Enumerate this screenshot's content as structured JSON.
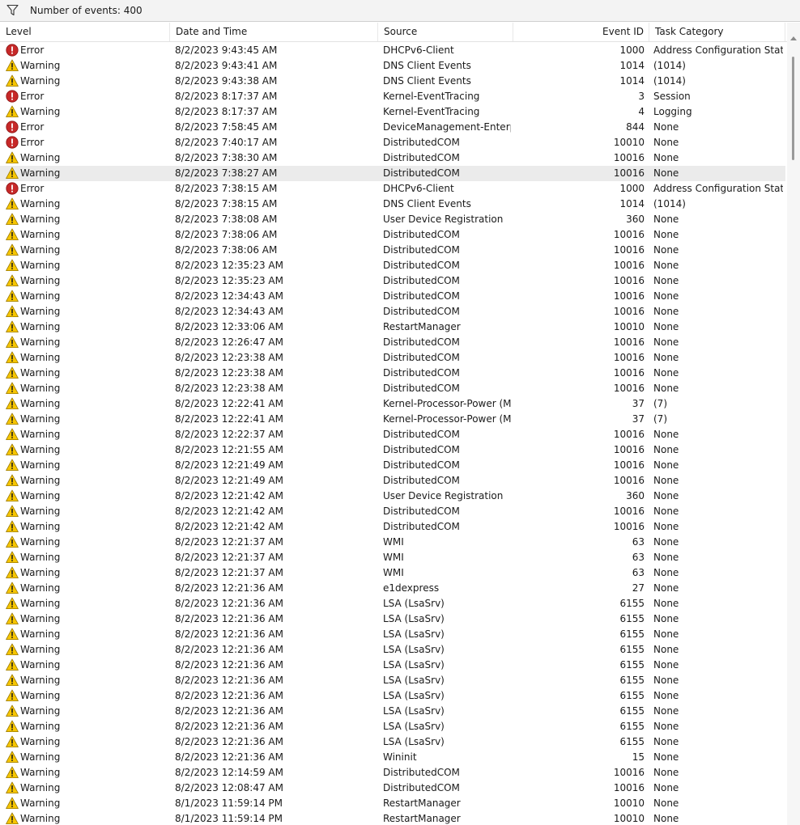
{
  "toolbar": {
    "event_count": "Number of events: 400",
    "filter_icon": "filter-funnel-icon"
  },
  "columns": {
    "level": "Level",
    "date": "Date and Time",
    "source": "Source",
    "event_id": "Event ID",
    "category": "Task Category"
  },
  "colors": {
    "error": "#c62828",
    "warning": "#f7c600",
    "selected_row": "#ebebeb"
  },
  "icons": {
    "error": "error-icon",
    "warning": "warning-icon"
  },
  "selected_row_index": 8,
  "rows": [
    {
      "level": "Error",
      "type": "error",
      "date": "8/2/2023 9:43:45 AM",
      "source": "DHCPv6-Client",
      "id": "1000",
      "category": "Address Configuration Stat…"
    },
    {
      "level": "Warning",
      "type": "warning",
      "date": "8/2/2023 9:43:41 AM",
      "source": "DNS Client Events",
      "id": "1014",
      "category": "(1014)"
    },
    {
      "level": "Warning",
      "type": "warning",
      "date": "8/2/2023 9:43:38 AM",
      "source": "DNS Client Events",
      "id": "1014",
      "category": "(1014)"
    },
    {
      "level": "Error",
      "type": "error",
      "date": "8/2/2023 8:17:37 AM",
      "source": "Kernel-EventTracing",
      "id": "3",
      "category": "Session"
    },
    {
      "level": "Warning",
      "type": "warning",
      "date": "8/2/2023 8:17:37 AM",
      "source": "Kernel-EventTracing",
      "id": "4",
      "category": "Logging"
    },
    {
      "level": "Error",
      "type": "error",
      "date": "8/2/2023 7:58:45 AM",
      "source": "DeviceManagement-Enterp…",
      "id": "844",
      "category": "None"
    },
    {
      "level": "Error",
      "type": "error",
      "date": "8/2/2023 7:40:17 AM",
      "source": "DistributedCOM",
      "id": "10010",
      "category": "None"
    },
    {
      "level": "Warning",
      "type": "warning",
      "date": "8/2/2023 7:38:30 AM",
      "source": "DistributedCOM",
      "id": "10016",
      "category": "None"
    },
    {
      "level": "Warning",
      "type": "warning",
      "date": "8/2/2023 7:38:27 AM",
      "source": "DistributedCOM",
      "id": "10016",
      "category": "None"
    },
    {
      "level": "Error",
      "type": "error",
      "date": "8/2/2023 7:38:15 AM",
      "source": "DHCPv6-Client",
      "id": "1000",
      "category": "Address Configuration Stat…"
    },
    {
      "level": "Warning",
      "type": "warning",
      "date": "8/2/2023 7:38:15 AM",
      "source": "DNS Client Events",
      "id": "1014",
      "category": "(1014)"
    },
    {
      "level": "Warning",
      "type": "warning",
      "date": "8/2/2023 7:38:08 AM",
      "source": "User Device Registration",
      "id": "360",
      "category": "None"
    },
    {
      "level": "Warning",
      "type": "warning",
      "date": "8/2/2023 7:38:06 AM",
      "source": "DistributedCOM",
      "id": "10016",
      "category": "None"
    },
    {
      "level": "Warning",
      "type": "warning",
      "date": "8/2/2023 7:38:06 AM",
      "source": "DistributedCOM",
      "id": "10016",
      "category": "None"
    },
    {
      "level": "Warning",
      "type": "warning",
      "date": "8/2/2023 12:35:23 AM",
      "source": "DistributedCOM",
      "id": "10016",
      "category": "None"
    },
    {
      "level": "Warning",
      "type": "warning",
      "date": "8/2/2023 12:35:23 AM",
      "source": "DistributedCOM",
      "id": "10016",
      "category": "None"
    },
    {
      "level": "Warning",
      "type": "warning",
      "date": "8/2/2023 12:34:43 AM",
      "source": "DistributedCOM",
      "id": "10016",
      "category": "None"
    },
    {
      "level": "Warning",
      "type": "warning",
      "date": "8/2/2023 12:34:43 AM",
      "source": "DistributedCOM",
      "id": "10016",
      "category": "None"
    },
    {
      "level": "Warning",
      "type": "warning",
      "date": "8/2/2023 12:33:06 AM",
      "source": "RestartManager",
      "id": "10010",
      "category": "None"
    },
    {
      "level": "Warning",
      "type": "warning",
      "date": "8/2/2023 12:26:47 AM",
      "source": "DistributedCOM",
      "id": "10016",
      "category": "None"
    },
    {
      "level": "Warning",
      "type": "warning",
      "date": "8/2/2023 12:23:38 AM",
      "source": "DistributedCOM",
      "id": "10016",
      "category": "None"
    },
    {
      "level": "Warning",
      "type": "warning",
      "date": "8/2/2023 12:23:38 AM",
      "source": "DistributedCOM",
      "id": "10016",
      "category": "None"
    },
    {
      "level": "Warning",
      "type": "warning",
      "date": "8/2/2023 12:23:38 AM",
      "source": "DistributedCOM",
      "id": "10016",
      "category": "None"
    },
    {
      "level": "Warning",
      "type": "warning",
      "date": "8/2/2023 12:22:41 AM",
      "source": "Kernel-Processor-Power (M…",
      "id": "37",
      "category": "(7)"
    },
    {
      "level": "Warning",
      "type": "warning",
      "date": "8/2/2023 12:22:41 AM",
      "source": "Kernel-Processor-Power (M…",
      "id": "37",
      "category": "(7)"
    },
    {
      "level": "Warning",
      "type": "warning",
      "date": "8/2/2023 12:22:37 AM",
      "source": "DistributedCOM",
      "id": "10016",
      "category": "None"
    },
    {
      "level": "Warning",
      "type": "warning",
      "date": "8/2/2023 12:21:55 AM",
      "source": "DistributedCOM",
      "id": "10016",
      "category": "None"
    },
    {
      "level": "Warning",
      "type": "warning",
      "date": "8/2/2023 12:21:49 AM",
      "source": "DistributedCOM",
      "id": "10016",
      "category": "None"
    },
    {
      "level": "Warning",
      "type": "warning",
      "date": "8/2/2023 12:21:49 AM",
      "source": "DistributedCOM",
      "id": "10016",
      "category": "None"
    },
    {
      "level": "Warning",
      "type": "warning",
      "date": "8/2/2023 12:21:42 AM",
      "source": "User Device Registration",
      "id": "360",
      "category": "None"
    },
    {
      "level": "Warning",
      "type": "warning",
      "date": "8/2/2023 12:21:42 AM",
      "source": "DistributedCOM",
      "id": "10016",
      "category": "None"
    },
    {
      "level": "Warning",
      "type": "warning",
      "date": "8/2/2023 12:21:42 AM",
      "source": "DistributedCOM",
      "id": "10016",
      "category": "None"
    },
    {
      "level": "Warning",
      "type": "warning",
      "date": "8/2/2023 12:21:37 AM",
      "source": "WMI",
      "id": "63",
      "category": "None"
    },
    {
      "level": "Warning",
      "type": "warning",
      "date": "8/2/2023 12:21:37 AM",
      "source": "WMI",
      "id": "63",
      "category": "None"
    },
    {
      "level": "Warning",
      "type": "warning",
      "date": "8/2/2023 12:21:37 AM",
      "source": "WMI",
      "id": "63",
      "category": "None"
    },
    {
      "level": "Warning",
      "type": "warning",
      "date": "8/2/2023 12:21:36 AM",
      "source": "e1dexpress",
      "id": "27",
      "category": "None"
    },
    {
      "level": "Warning",
      "type": "warning",
      "date": "8/2/2023 12:21:36 AM",
      "source": "LSA (LsaSrv)",
      "id": "6155",
      "category": "None"
    },
    {
      "level": "Warning",
      "type": "warning",
      "date": "8/2/2023 12:21:36 AM",
      "source": "LSA (LsaSrv)",
      "id": "6155",
      "category": "None"
    },
    {
      "level": "Warning",
      "type": "warning",
      "date": "8/2/2023 12:21:36 AM",
      "source": "LSA (LsaSrv)",
      "id": "6155",
      "category": "None"
    },
    {
      "level": "Warning",
      "type": "warning",
      "date": "8/2/2023 12:21:36 AM",
      "source": "LSA (LsaSrv)",
      "id": "6155",
      "category": "None"
    },
    {
      "level": "Warning",
      "type": "warning",
      "date": "8/2/2023 12:21:36 AM",
      "source": "LSA (LsaSrv)",
      "id": "6155",
      "category": "None"
    },
    {
      "level": "Warning",
      "type": "warning",
      "date": "8/2/2023 12:21:36 AM",
      "source": "LSA (LsaSrv)",
      "id": "6155",
      "category": "None"
    },
    {
      "level": "Warning",
      "type": "warning",
      "date": "8/2/2023 12:21:36 AM",
      "source": "LSA (LsaSrv)",
      "id": "6155",
      "category": "None"
    },
    {
      "level": "Warning",
      "type": "warning",
      "date": "8/2/2023 12:21:36 AM",
      "source": "LSA (LsaSrv)",
      "id": "6155",
      "category": "None"
    },
    {
      "level": "Warning",
      "type": "warning",
      "date": "8/2/2023 12:21:36 AM",
      "source": "LSA (LsaSrv)",
      "id": "6155",
      "category": "None"
    },
    {
      "level": "Warning",
      "type": "warning",
      "date": "8/2/2023 12:21:36 AM",
      "source": "LSA (LsaSrv)",
      "id": "6155",
      "category": "None"
    },
    {
      "level": "Warning",
      "type": "warning",
      "date": "8/2/2023 12:21:36 AM",
      "source": "Wininit",
      "id": "15",
      "category": "None"
    },
    {
      "level": "Warning",
      "type": "warning",
      "date": "8/2/2023 12:14:59 AM",
      "source": "DistributedCOM",
      "id": "10016",
      "category": "None"
    },
    {
      "level": "Warning",
      "type": "warning",
      "date": "8/2/2023 12:08:47 AM",
      "source": "DistributedCOM",
      "id": "10016",
      "category": "None"
    },
    {
      "level": "Warning",
      "type": "warning",
      "date": "8/1/2023 11:59:14 PM",
      "source": "RestartManager",
      "id": "10010",
      "category": "None"
    },
    {
      "level": "Warning",
      "type": "warning",
      "date": "8/1/2023 11:59:14 PM",
      "source": "RestartManager",
      "id": "10010",
      "category": "None"
    }
  ]
}
